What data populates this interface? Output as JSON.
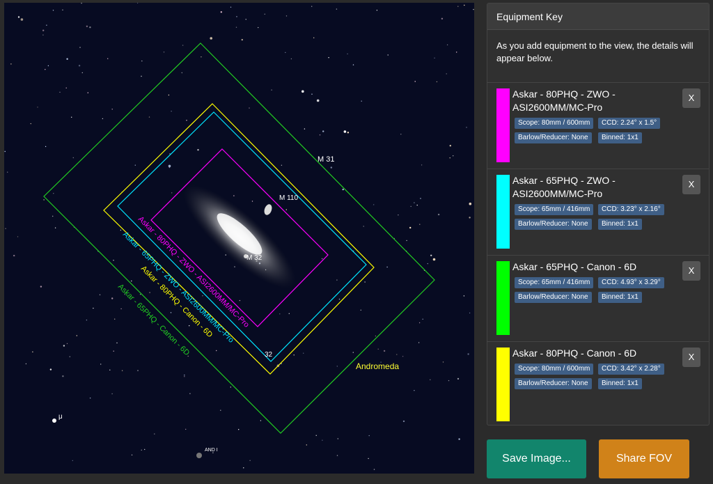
{
  "sky": {
    "object_labels": [
      "M 31",
      "M 110",
      "M 32",
      "32",
      "Andromeda",
      "μ",
      "AND I"
    ],
    "fov_labels": [
      "Askar - 65PHQ - Canon - 6D",
      "Askar - 80PHQ - Canon - 6D",
      "Askar - 65PHQ - ZWO - ASI2600MM/MC-Pro",
      "Askar - 80PHQ - ZWO - ASI2600MM/MC-Pro"
    ],
    "colors": {
      "magenta": "#ff00ff",
      "cyan": "#00e5ff",
      "green": "#22cc22",
      "yellow": "#ffff00"
    }
  },
  "panel": {
    "header": "Equipment Key",
    "intro": "As you add equipment to the view, the details will appear below.",
    "items": [
      {
        "name": "Askar - 80PHQ - ZWO - ASI2600MM/MC-Pro",
        "color": "#ff00ff",
        "scope": "Scope: 80mm / 600mm",
        "ccd": "CCD: 2.24° x 1.5°",
        "barlow": "Barlow/Reducer: None",
        "binned": "Binned: 1x1",
        "remove": "X"
      },
      {
        "name": "Askar - 65PHQ - ZWO - ASI2600MM/MC-Pro",
        "color": "#00ffff",
        "scope": "Scope: 65mm / 416mm",
        "ccd": "CCD: 3.23° x 2.16°",
        "barlow": "Barlow/Reducer: None",
        "binned": "Binned: 1x1",
        "remove": "X"
      },
      {
        "name": "Askar - 65PHQ - Canon - 6D",
        "color": "#00ff00",
        "scope": "Scope: 65mm / 416mm",
        "ccd": "CCD: 4.93° x 3.29°",
        "barlow": "Barlow/Reducer: None",
        "binned": "Binned: 1x1",
        "remove": "X"
      },
      {
        "name": "Askar - 80PHQ - Canon - 6D",
        "color": "#ffff00",
        "scope": "Scope: 80mm / 600mm",
        "ccd": "CCD: 3.42° x 2.28°",
        "barlow": "Barlow/Reducer: None",
        "binned": "Binned: 1x1",
        "remove": "X"
      }
    ]
  },
  "buttons": {
    "save": "Save Image...",
    "share": "Share FOV"
  }
}
